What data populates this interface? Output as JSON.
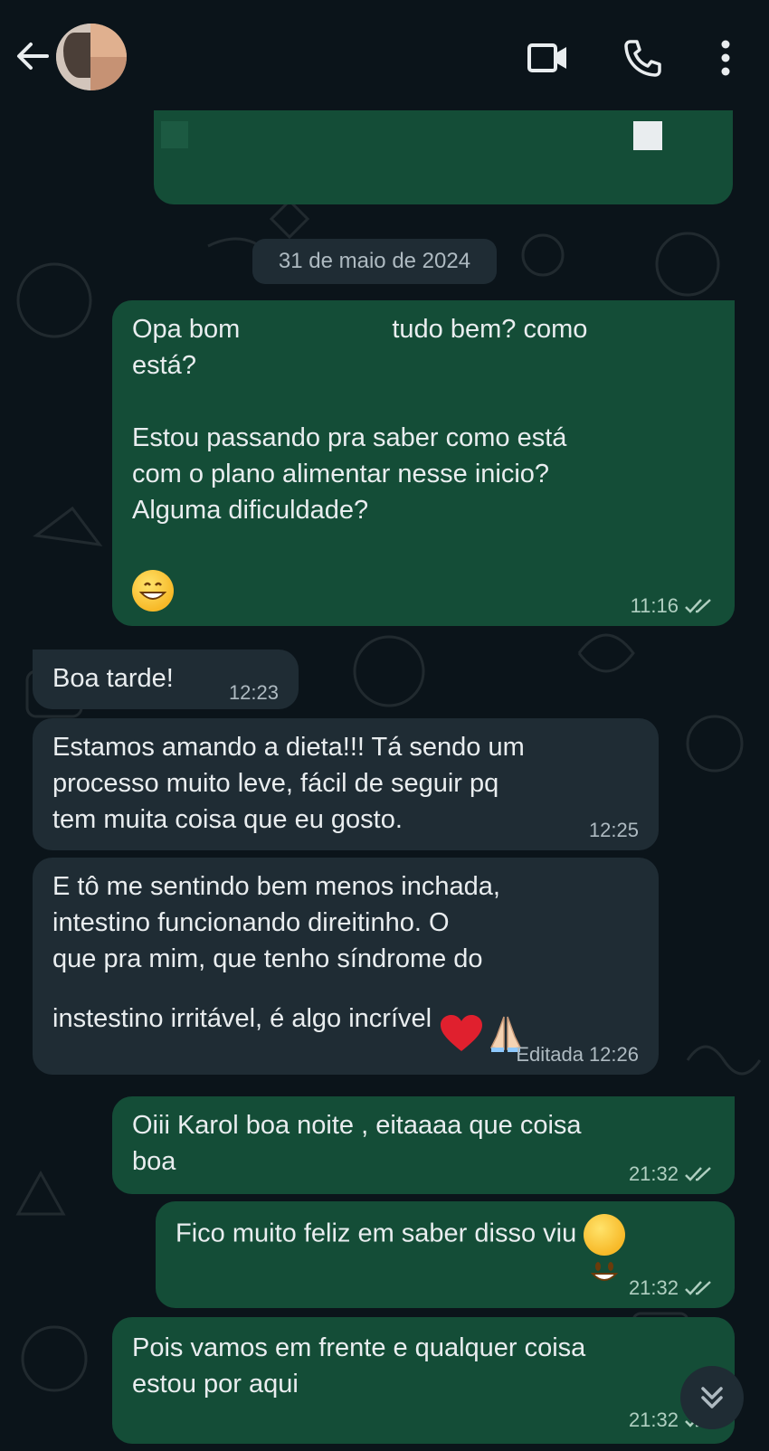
{
  "header": {
    "back_icon": "arrow-left-icon",
    "video_icon": "video-camera-icon",
    "call_icon": "phone-icon",
    "menu_icon": "more-vertical-icon"
  },
  "date_separator": "31 de maio de 2024",
  "messages": [
    {
      "direction": "out",
      "text_part1": "Opa bom ",
      "text_part2": "tudo bem? como",
      "text_rest": "está?\n\nEstou passando pra saber como está\ncom o plano alimentar nesse inicio?\nAlguma dificuldade?",
      "emoji": "grinning-face-icon",
      "time": "11:16",
      "status": "read"
    },
    {
      "direction": "in",
      "text": "Boa tarde!",
      "time": "12:23"
    },
    {
      "direction": "in",
      "text": "Estamos amando a dieta!!! Tá sendo um\nprocesso muito leve, fácil de seguir pq\ntem muita coisa que eu gosto.",
      "time": "12:25"
    },
    {
      "direction": "in",
      "text": "E tô me sentindo bem menos inchada,\nintestino funcionando direitinho. O\nque pra mim, que tenho síndrome do\ninstestino irritável, é algo incrível ",
      "emojis": [
        "red-heart-icon",
        "folded-hands-icon"
      ],
      "edited_label": "Editada",
      "time": "12:26"
    },
    {
      "direction": "out",
      "text": "Oiii Karol boa noite , eitaaaa que coisa\nboa",
      "time": "21:32",
      "status": "read"
    },
    {
      "direction": "out",
      "text": "Fico muito feliz em saber disso viu ",
      "emoji": "smiling-face-icon",
      "time": "21:32",
      "status": "read"
    },
    {
      "direction": "out",
      "text": "Pois vamos em frente e qualquer coisa\nestou por aqui",
      "time": "21:32",
      "status": "read"
    }
  ],
  "colors": {
    "background": "#0b141a",
    "outgoing_bubble": "#144d37",
    "incoming_bubble": "#1f2c34",
    "text": "#e9edef",
    "meta": "#aebac1",
    "read_ticks": "#b0cfc1"
  },
  "scroll_icon": "chevrons-down-icon"
}
